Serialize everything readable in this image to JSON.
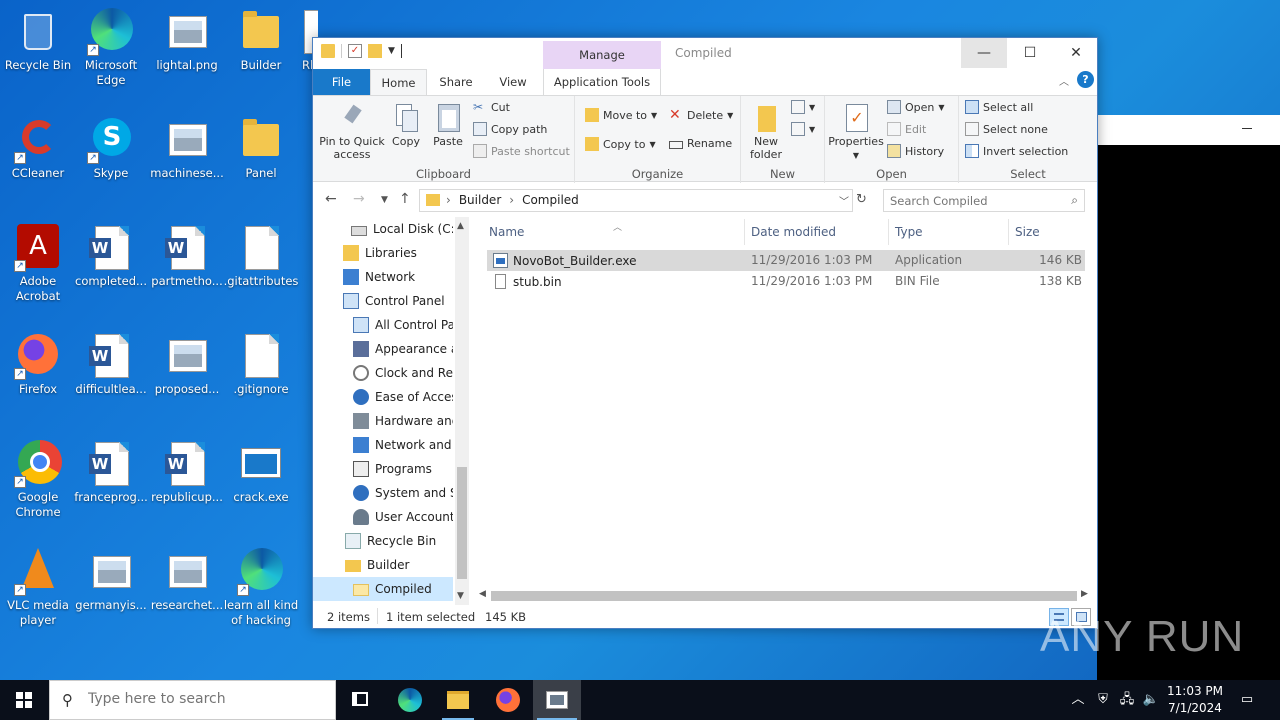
{
  "desktop": {
    "icons": [
      {
        "label": "Recycle Bin"
      },
      {
        "label": "Microsoft Edge"
      },
      {
        "label": "lightal.png"
      },
      {
        "label": "Builder"
      },
      {
        "label": "Rl"
      },
      {
        "label": "CCleaner"
      },
      {
        "label": "Skype"
      },
      {
        "label": "machinese..."
      },
      {
        "label": "Panel"
      },
      {
        "label": "Adobe Acrobat"
      },
      {
        "label": "completed..."
      },
      {
        "label": "partmetho..."
      },
      {
        "label": ".gitattributes"
      },
      {
        "label": "Firefox"
      },
      {
        "label": "difficultlea..."
      },
      {
        "label": "proposed..."
      },
      {
        "label": ".gitignore"
      },
      {
        "label": "Google Chrome"
      },
      {
        "label": "franceprog..."
      },
      {
        "label": "republicup..."
      },
      {
        "label": "crack.exe"
      },
      {
        "label": "VLC media player"
      },
      {
        "label": "germanyis..."
      },
      {
        "label": "researchet..."
      },
      {
        "label": "learn all kind of hacking"
      }
    ]
  },
  "explorer": {
    "title": "Compiled",
    "contextual_tab": "Manage",
    "tabs": {
      "file": "File",
      "home": "Home",
      "share": "Share",
      "view": "View",
      "apptools": "Application Tools"
    },
    "ribbon": {
      "clipboard": {
        "label": "Clipboard",
        "pin": "Pin to Quick access",
        "copy": "Copy",
        "paste": "Paste",
        "cut": "Cut",
        "copy_path": "Copy path",
        "paste_shortcut": "Paste shortcut"
      },
      "organize": {
        "label": "Organize",
        "move_to": "Move to",
        "copy_to": "Copy to",
        "delete": "Delete",
        "rename": "Rename"
      },
      "new": {
        "label": "New",
        "new_folder": "New folder"
      },
      "open": {
        "label": "Open",
        "properties": "Properties",
        "open": "Open",
        "edit": "Edit",
        "history": "History"
      },
      "select": {
        "label": "Select",
        "select_all": "Select all",
        "select_none": "Select none",
        "invert": "Invert selection"
      }
    },
    "address": {
      "crumbs": [
        "Builder",
        "Compiled"
      ],
      "search_placeholder": "Search Compiled"
    },
    "nav": [
      {
        "label": "Local Disk (C:)"
      },
      {
        "label": "Libraries"
      },
      {
        "label": "Network"
      },
      {
        "label": "Control Panel"
      },
      {
        "label": "All Control Par"
      },
      {
        "label": "Appearance an"
      },
      {
        "label": "Clock and Regi"
      },
      {
        "label": "Ease of Access"
      },
      {
        "label": "Hardware and"
      },
      {
        "label": "Network and Ir"
      },
      {
        "label": "Programs"
      },
      {
        "label": "System and Se"
      },
      {
        "label": "User Accounts"
      },
      {
        "label": "Recycle Bin"
      },
      {
        "label": "Builder"
      },
      {
        "label": "Compiled"
      }
    ],
    "columns": {
      "name": "Name",
      "date": "Date modified",
      "type": "Type",
      "size": "Size"
    },
    "files": [
      {
        "name": "NovoBot_Builder.exe",
        "date": "11/29/2016 1:03 PM",
        "type": "Application",
        "size": "146 KB"
      },
      {
        "name": "stub.bin",
        "date": "11/29/2016 1:03 PM",
        "type": "BIN File",
        "size": "138 KB"
      }
    ],
    "status": {
      "count": "2 items",
      "selected": "1 item selected",
      "size": "145 KB"
    }
  },
  "taskbar": {
    "search_placeholder": "Type here to search",
    "time": "11:03 PM",
    "date": "7/1/2024"
  },
  "watermark": "ANY RUN",
  "colors": {
    "accent": "#1979ca",
    "selection": "#cce8ff",
    "manage_tab": "#e8d5f5"
  }
}
